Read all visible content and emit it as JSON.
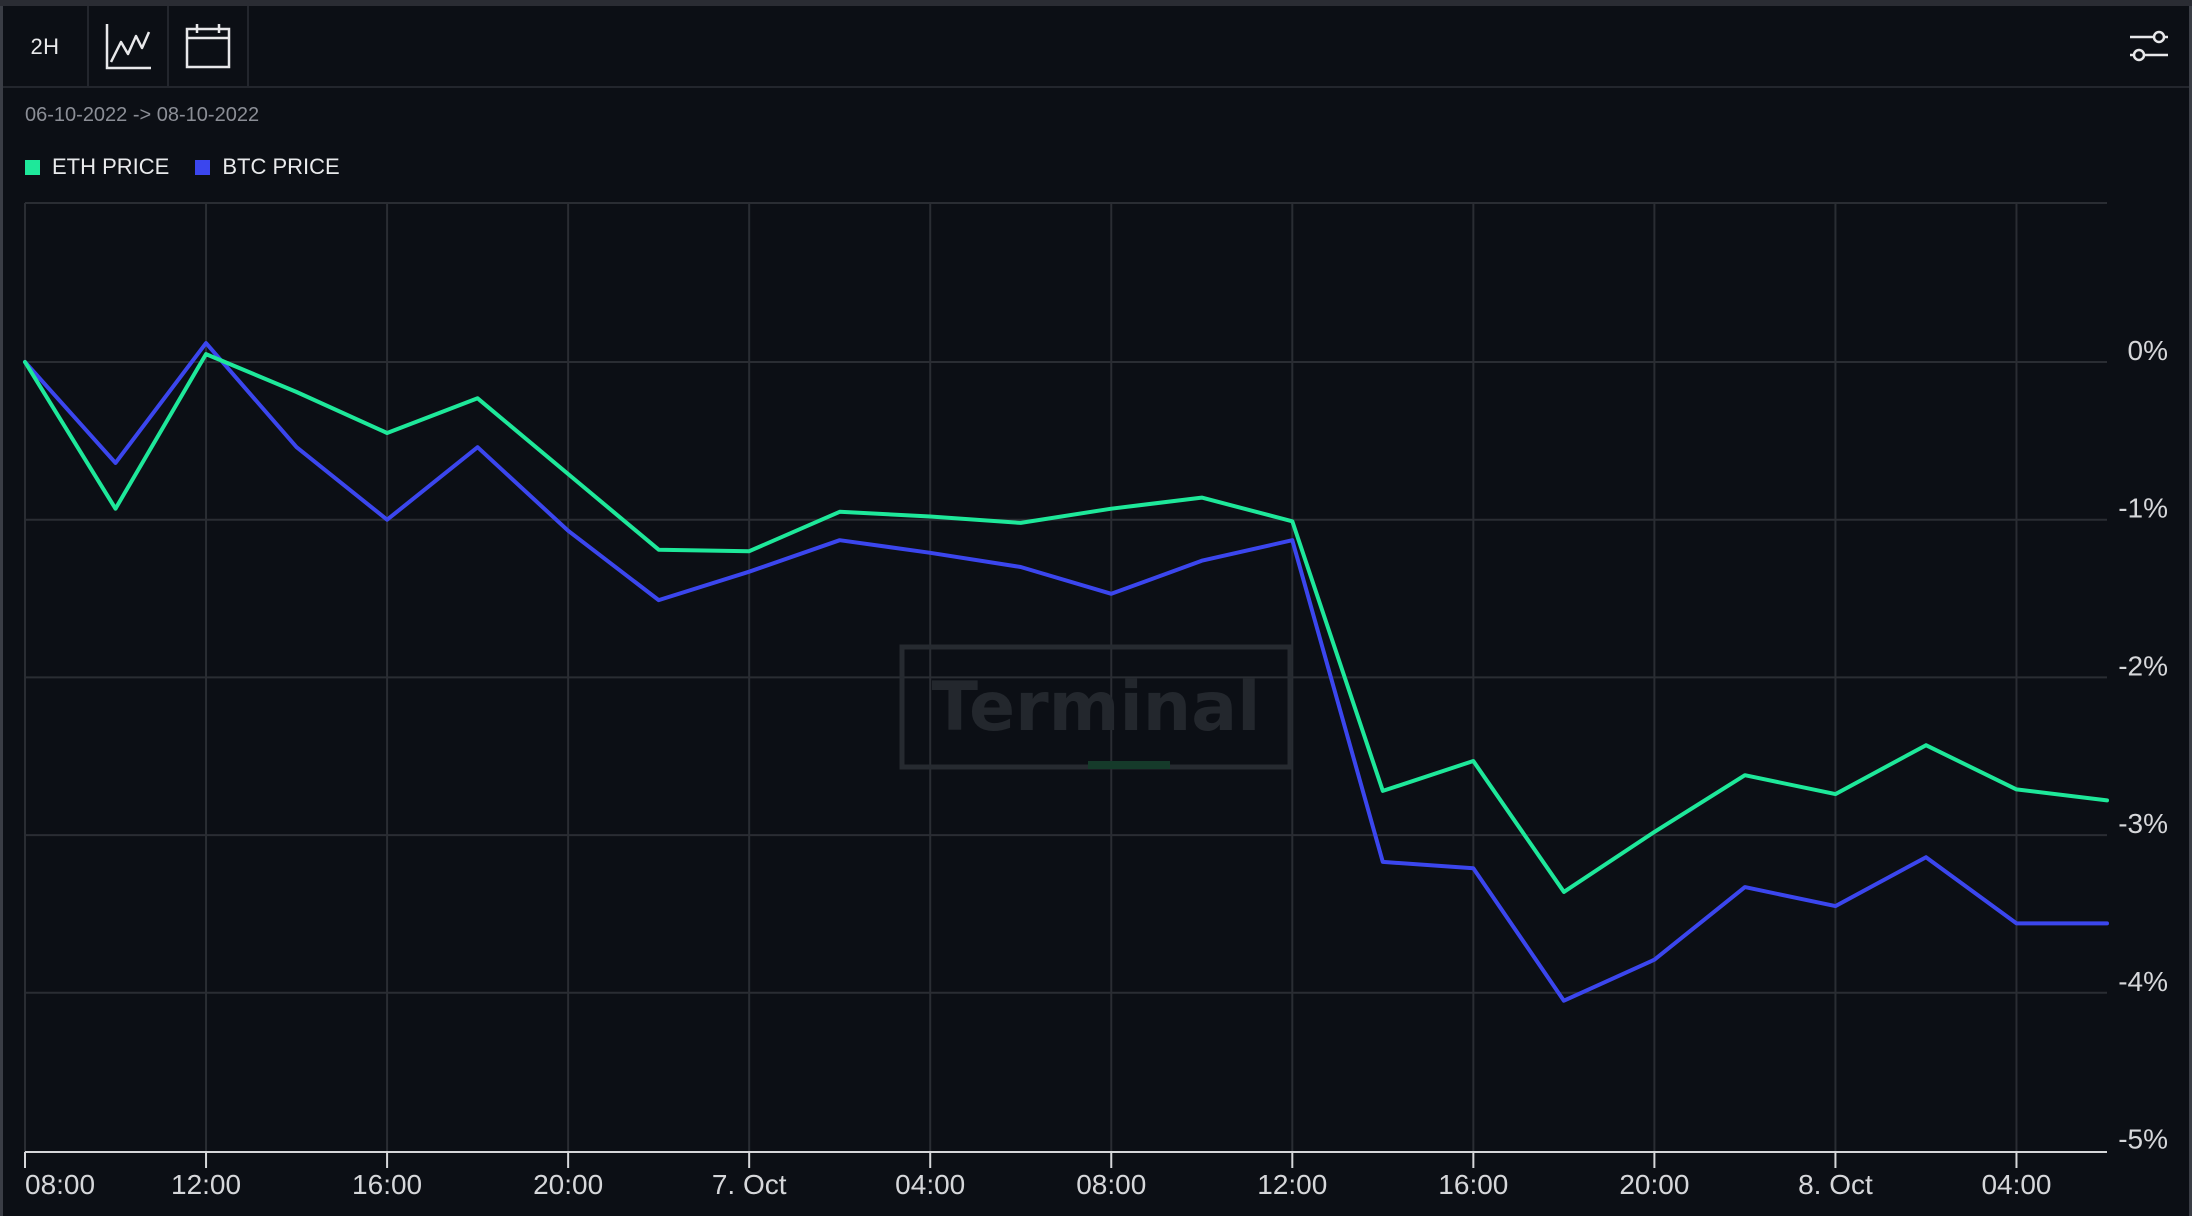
{
  "toolbar": {
    "interval_label": "2H",
    "chart_type_icon": "line-chart-icon",
    "calendar_icon": "calendar-icon",
    "settings_icon": "sliders-icon"
  },
  "date_range": "06-10-2022 -> 08-10-2022",
  "watermark": "Terminal",
  "colors": {
    "eth": "#1ee89a",
    "btc": "#3b46ee",
    "background": "#0c0f15",
    "grid": "#2a2d33"
  },
  "chart_data": {
    "type": "line",
    "x": [
      "08:00",
      "10:00",
      "12:00",
      "14:00",
      "16:00",
      "18:00",
      "20:00",
      "22:00",
      "7. Oct",
      "02:00",
      "04:00",
      "06:00",
      "08:00",
      "10:00",
      "12:00",
      "14:00",
      "16:00",
      "18:00",
      "20:00",
      "22:00",
      "8. Oct",
      "02:00",
      "04:00",
      "06:00"
    ],
    "x_tick_labels": [
      "08:00",
      "12:00",
      "16:00",
      "20:00",
      "7. Oct",
      "04:00",
      "08:00",
      "12:00",
      "16:00",
      "20:00",
      "8. Oct",
      "04:00"
    ],
    "series": [
      {
        "name": "ETH PRICE",
        "color": "#1ee89a",
        "values": [
          0,
          -0.93,
          0.05,
          -0.19,
          -0.45,
          -0.23,
          -0.71,
          -1.19,
          -1.2,
          -0.95,
          -0.98,
          -1.02,
          -0.93,
          -0.86,
          -1.01,
          -2.72,
          -2.53,
          -3.36,
          -2.98,
          -2.62,
          -2.74,
          -2.43,
          -2.71,
          -2.78
        ]
      },
      {
        "name": "BTC PRICE",
        "color": "#3b46ee",
        "values": [
          0,
          -0.64,
          0.12,
          -0.54,
          -1.0,
          -0.54,
          -1.07,
          -1.51,
          -1.33,
          -1.13,
          -1.21,
          -1.3,
          -1.47,
          -1.26,
          -1.13,
          -3.17,
          -3.21,
          -4.05,
          -3.79,
          -3.33,
          -3.45,
          -3.14,
          -3.56,
          -3.56
        ]
      }
    ],
    "y_ticks": [
      0,
      -1,
      -2,
      -3,
      -4,
      -5
    ],
    "y_tick_labels": [
      "0%",
      "-1%",
      "-2%",
      "-3%",
      "-4%",
      "-5%"
    ],
    "ylim": [
      -5,
      1
    ],
    "grid": true,
    "legend_position": "top-left",
    "y_axis_side": "right"
  }
}
